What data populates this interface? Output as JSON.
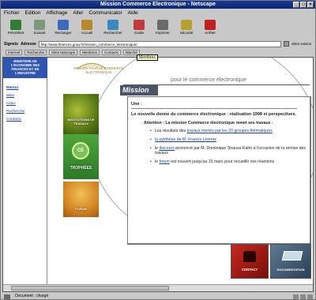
{
  "window": {
    "title": "Mission Commerce Electronique - Netscape"
  },
  "menubar": [
    "Fichier",
    "Edition",
    "Affichage",
    "Aller",
    "Communicator",
    "Aide"
  ],
  "toolbar": [
    {
      "label": "Précédent",
      "icon": "back-arrow-icon",
      "color": "#2e7d32"
    },
    {
      "label": "Suivant",
      "icon": "forward-arrow-icon",
      "color": "#7a9a7a"
    },
    {
      "label": "Recharger",
      "icon": "reload-icon",
      "color": "#3a6ab8"
    },
    {
      "label": "Accueil",
      "icon": "home-icon",
      "color": "#b8892a"
    },
    {
      "label": "Rechercher",
      "icon": "search-icon",
      "color": "#3a8ac0"
    },
    {
      "label": "Guide",
      "icon": "guide-icon",
      "color": "#c03a3a"
    },
    {
      "label": "Imprimer",
      "icon": "print-icon",
      "color": "#6a6a6a"
    },
    {
      "label": "Sécurité",
      "icon": "lock-icon",
      "color": "#b8a030"
    },
    {
      "label": "Arrêter",
      "icon": "stop-icon",
      "color": "#c02020"
    }
  ],
  "address": {
    "signets_label": "Signets",
    "location_label": "Adresse",
    "url": "http://www.finances.gouv.fr/mission_commerce_electronique/",
    "related_label": "Sites voisins"
  },
  "linkbar": [
    "Internet",
    "Recherche",
    "Sites Netscape",
    "Membres",
    "Contacts",
    "Marché"
  ],
  "tooltip": "Membres",
  "site": {
    "nav_top": "MINISTERE DE L'ECONOMIE DES FINANCES ET DE L'INDUSTRIE",
    "nav_items": [
      "Retour",
      "Mise",
      "Index",
      "Recherche",
      "Contacts"
    ],
    "logo_text": "MISSION POUR LE COMMERCE ELECTRONIQUE",
    "header_title": "Mission",
    "header_subtitle": "pour le commerce électronique",
    "tiles": [
      {
        "caption": "INSTITUTIONS DE TRAVAUX",
        "icon": "institutions-image"
      },
      {
        "caption": "TROPHÉES",
        "icon": "trophy-image",
        "badge": "CE"
      },
      {
        "caption": "FORUM",
        "icon": "forum-image"
      }
    ],
    "panel": {
      "section": "Une :",
      "intro": "Le nouvelle donne du commerce électronique : réalisation 1998 et perspectives.",
      "notice": "Attention : La mission Commerce électronique remet ses travaux :",
      "bullets": [
        {
          "before": "Les résultats des ",
          "link": "travaux menés par les 20 groupes thématiques",
          "after": ""
        },
        {
          "before": "",
          "link": "la synthèse de M. Francis Lorentz",
          "after": ""
        },
        {
          "before": "le ",
          "link": "discours",
          "after": " prononcé par M. Dominique Strauss-Kahn à l'occasion de la remise des travaux"
        },
        {
          "before": "le ",
          "link": "forum",
          "after": " est nouvert jusqu'au 15 mars pour recueillir vos réactions"
        }
      ]
    },
    "buttons": [
      {
        "caption": "CONTACT"
      },
      {
        "caption": "DOCUMENTATION"
      }
    ]
  },
  "status": {
    "text": "Document : chargé"
  }
}
